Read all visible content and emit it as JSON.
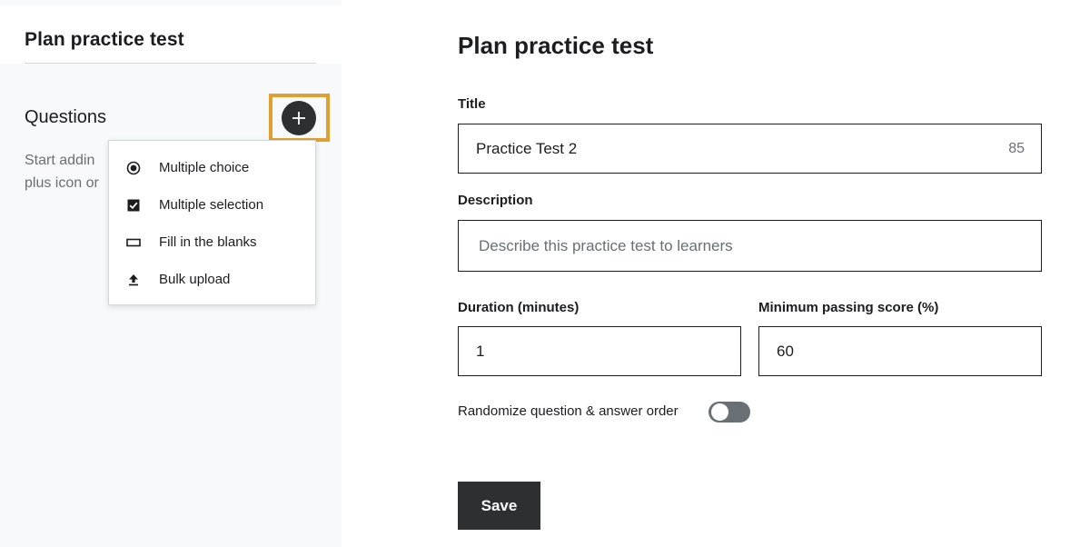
{
  "sidebar": {
    "title": "Plan practice test",
    "questions_heading": "Questions",
    "hint_text": "Start addin\nplus icon or",
    "add_button_icon": "plus-icon"
  },
  "add_menu": {
    "items": [
      {
        "label": "Multiple choice",
        "icon": "radio-icon"
      },
      {
        "label": "Multiple selection",
        "icon": "checkbox-icon"
      },
      {
        "label": "Fill in the blanks",
        "icon": "blank-box-icon"
      },
      {
        "label": "Bulk upload",
        "icon": "upload-icon"
      }
    ]
  },
  "form": {
    "title": "Plan practice test",
    "title_label": "Title",
    "title_value": "Practice Test 2",
    "title_char_count": "85",
    "description_label": "Description",
    "description_placeholder": "Describe this practice test to learners",
    "duration_label": "Duration (minutes)",
    "duration_value": "1",
    "min_score_label": "Minimum passing score (%)",
    "min_score_value": "60",
    "randomize_label": "Randomize question & answer order",
    "randomize_enabled": false,
    "save_label": "Save"
  },
  "colors": {
    "highlight": "#e0a030",
    "dark": "#2d2f31",
    "sidebar_bg": "#f7f9fa",
    "toggle_off": "#6a6f73"
  }
}
